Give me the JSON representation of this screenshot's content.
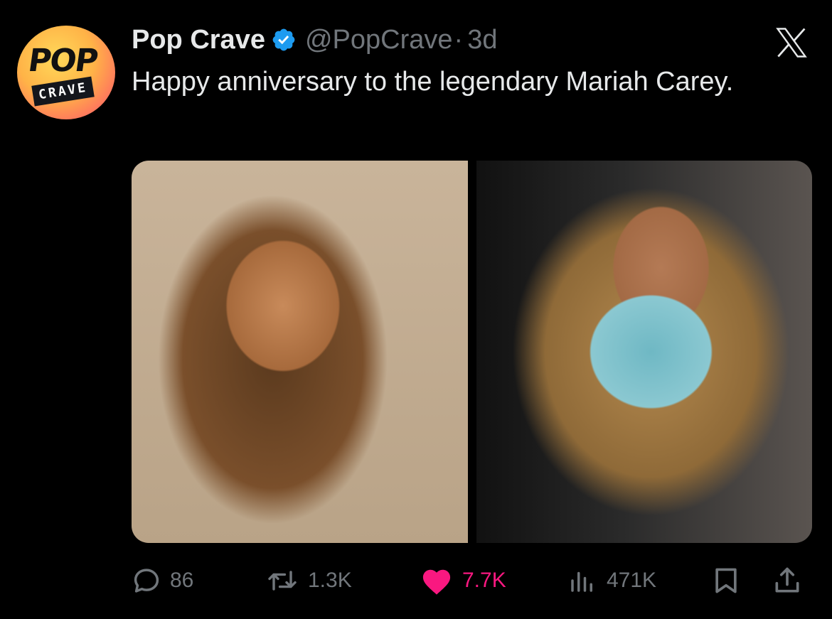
{
  "author": {
    "name": "Pop Crave",
    "handle": "@PopCrave",
    "separator": "·",
    "timestamp": "3d",
    "avatar_text_top": "POP",
    "avatar_text_bottom": "CRAVE",
    "verified": true
  },
  "tweet": {
    "text": "Happy anniversary to the legendary Mariah Carey."
  },
  "media": {
    "images": [
      {
        "subject": "photo-left"
      },
      {
        "subject": "photo-right"
      }
    ]
  },
  "actions": {
    "replies": "86",
    "retweets": "1.3K",
    "likes": "7.7K",
    "views": "471K"
  },
  "colors": {
    "background": "#000000",
    "text": "#e7e9ea",
    "secondary": "#71767b",
    "verified": "#1d9bf0",
    "like": "#f91880"
  }
}
